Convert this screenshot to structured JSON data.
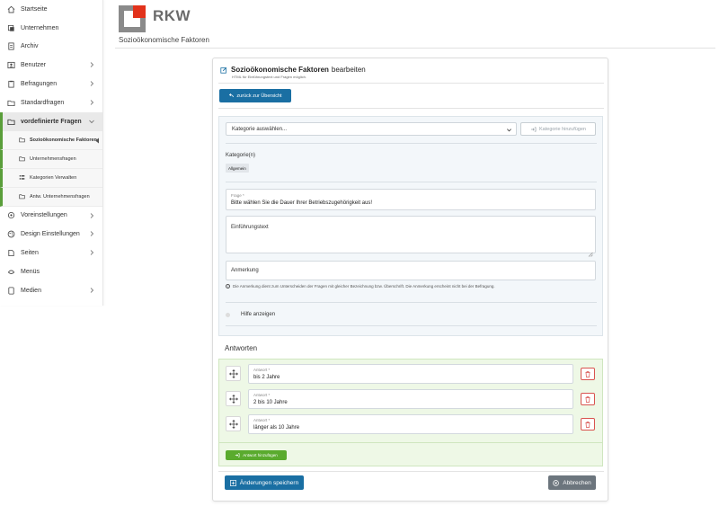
{
  "sidebar": {
    "items": [
      {
        "label": "Startseite",
        "icon": "home-icon"
      },
      {
        "label": "Unternehmen",
        "icon": "building-icon"
      },
      {
        "label": "Archiv",
        "icon": "archive-icon"
      },
      {
        "label": "Benutzer",
        "icon": "users-icon"
      },
      {
        "label": "Befragungen",
        "icon": "clipboard-icon"
      },
      {
        "label": "Standardfragen",
        "icon": "folder-icon"
      },
      {
        "label": "vordefinierte Fragen",
        "icon": "folder-open-icon"
      }
    ],
    "subitems": [
      {
        "label": "Sozioökonomische Faktoren"
      },
      {
        "label": "Unternehmensfragen"
      },
      {
        "label": "Kategorien Verwalten"
      },
      {
        "label": "Antw. Unternehmensfragen"
      }
    ],
    "items_after": [
      {
        "label": "Voreinstellungen",
        "icon": "sliders-icon"
      },
      {
        "label": "Design Einstellungen",
        "icon": "palette-icon"
      },
      {
        "label": "Seiten",
        "icon": "pages-icon"
      },
      {
        "label": "Menüs",
        "icon": "menu-icon"
      },
      {
        "label": "Medien",
        "icon": "media-icon"
      }
    ]
  },
  "header": {
    "brand": "RKW",
    "page_title": "Sozioökonomische Faktoren"
  },
  "card": {
    "title_bold": "Sozioökonomische Faktoren",
    "title_rest": "bearbeiten",
    "subtitle": "HTML für Einführungstext und Fragen möglich.",
    "back_button": "zurück zur Übersicht",
    "category_select": "Kategorie auswählen...",
    "add_category_button": "Kategorie hinzufügen",
    "categories_label": "Kategorie(n)",
    "category_badge": "Allgemein",
    "question_label": "Frage *",
    "question_value": "Bitte wählen Sie die Dauer Ihrer Betriebszugehörigkeit aus!",
    "intro_placeholder": "Einführungstext",
    "note_placeholder": "Anmerkung",
    "note_hint": "Die Anmerkung dient zum Unterscheiden der Fragen mit gleicher Bezeichnung bzw. Überschrift. Die Anmerkung erscheint nicht bei der Befragung.",
    "help_toggle": "Hilfe anzeigen",
    "answers_heading": "Antworten",
    "answers": [
      {
        "label": "Antwort *",
        "value": "bis 2 Jahre"
      },
      {
        "label": "Antwort *",
        "value": "2 bis 10 Jahre"
      },
      {
        "label": "Antwort *",
        "value": "länger als 10 Jahre"
      }
    ],
    "add_answer_button": "Antwort hinzufügen",
    "save_button": "Änderungen speichern",
    "cancel_button": "Abbrechen"
  },
  "colors": {
    "primary": "#1a6fa3",
    "success": "#5aab2e",
    "danger": "#d9534f",
    "secondary": "#6c757d",
    "brand_red": "#e2321b"
  }
}
